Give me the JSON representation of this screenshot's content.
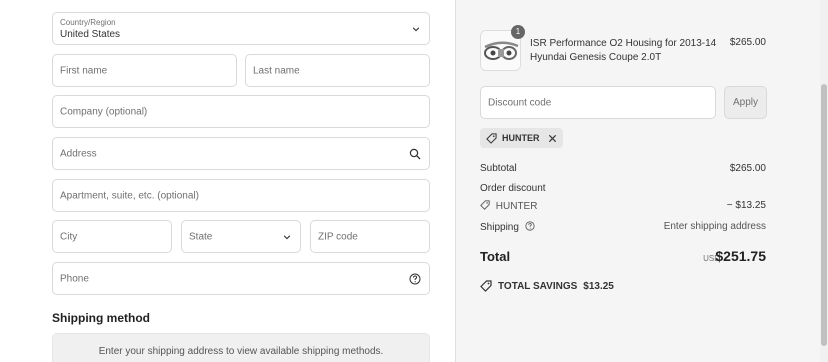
{
  "form": {
    "country": {
      "label": "Country/Region",
      "value": "United States"
    },
    "first_name": {
      "placeholder": "First name"
    },
    "last_name": {
      "placeholder": "Last name"
    },
    "company": {
      "placeholder": "Company (optional)"
    },
    "address": {
      "placeholder": "Address"
    },
    "apartment": {
      "placeholder": "Apartment, suite, etc. (optional)"
    },
    "city": {
      "placeholder": "City"
    },
    "state": {
      "value": "State"
    },
    "zip": {
      "placeholder": "ZIP code"
    },
    "phone": {
      "placeholder": "Phone"
    }
  },
  "shipping": {
    "title": "Shipping method",
    "message": "Enter your shipping address to view available shipping methods."
  },
  "summary": {
    "product": {
      "quantity": "1",
      "name": "ISR Performance O2 Housing for 2013-14 Hyundai Genesis Coupe 2.0T",
      "price": "$265.00"
    },
    "discount": {
      "placeholder": "Discount code",
      "apply_label": "Apply",
      "applied_code": "HUNTER"
    },
    "subtotal": {
      "label": "Subtotal",
      "value": "$265.00"
    },
    "order_discount": {
      "label": "Order discount",
      "code": "HUNTER",
      "value": "− $13.25"
    },
    "shipping": {
      "label": "Shipping",
      "value": "Enter shipping address"
    },
    "total": {
      "label": "Total",
      "currency": "USD",
      "value": "$251.75"
    },
    "savings": {
      "label": "TOTAL SAVINGS",
      "value": "$13.25"
    }
  },
  "colors": {
    "panel_bg": "#f5f5f5",
    "border": "#d9d9d9",
    "text": "#333333",
    "muted": "#707070"
  }
}
